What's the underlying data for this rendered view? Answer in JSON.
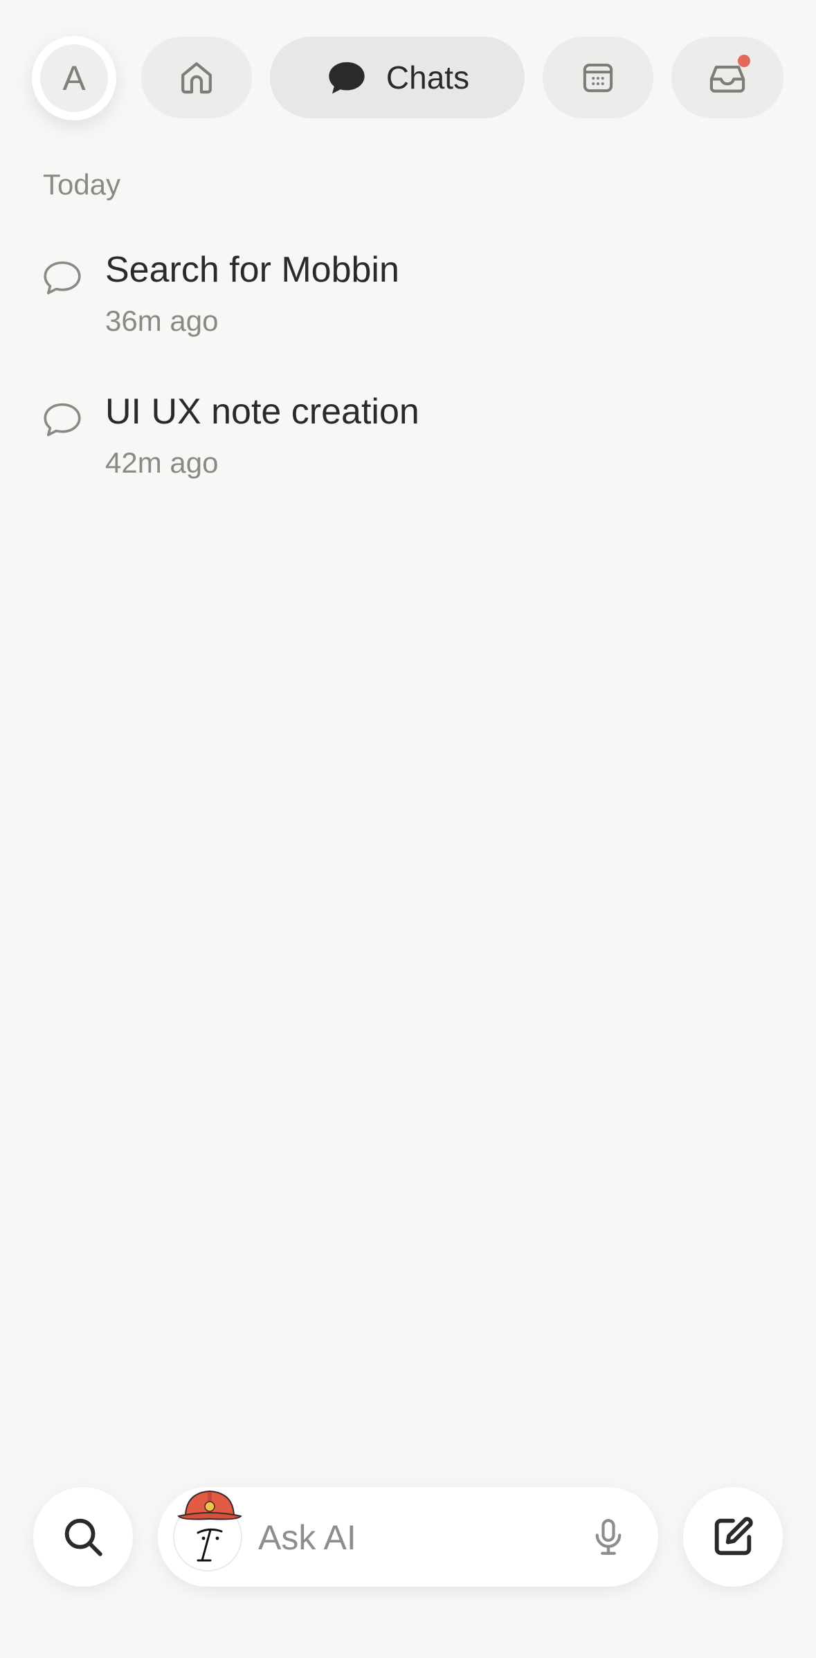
{
  "topnav": {
    "avatar_initial": "A",
    "chats_label": "Chats",
    "icons": [
      "home-icon",
      "chat-bubble-icon",
      "calendar-icon",
      "inbox-icon"
    ],
    "notification_color": "#e26a5c"
  },
  "list": {
    "section_label": "Today",
    "items": [
      {
        "title": "Search for Mobbin",
        "time": "36m ago"
      },
      {
        "title": "UI UX note creation",
        "time": "42m ago"
      }
    ]
  },
  "bottombar": {
    "ask_placeholder": "Ask AI",
    "icons": [
      "search-icon",
      "mascot-avatar",
      "microphone-icon",
      "compose-icon"
    ]
  },
  "colors": {
    "background": "#f8f7f5",
    "text_primary": "#2b2a28",
    "text_secondary": "#8a8986",
    "accent": "#e26a5c"
  }
}
